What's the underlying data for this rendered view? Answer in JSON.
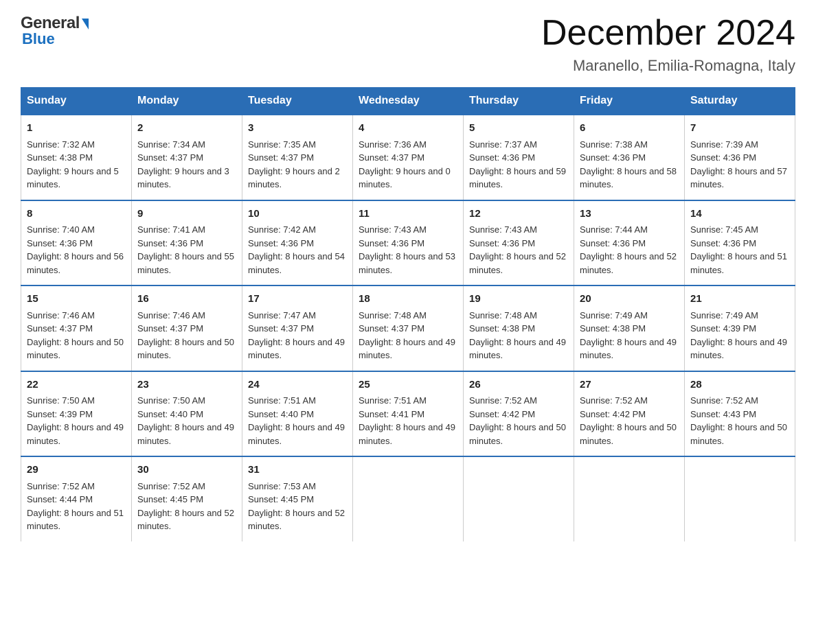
{
  "header": {
    "month_year": "December 2024",
    "location": "Maranello, Emilia-Romagna, Italy",
    "logo_general": "General",
    "logo_blue": "Blue"
  },
  "days_of_week": [
    "Sunday",
    "Monday",
    "Tuesday",
    "Wednesday",
    "Thursday",
    "Friday",
    "Saturday"
  ],
  "weeks": [
    [
      {
        "day": "1",
        "sunrise": "7:32 AM",
        "sunset": "4:38 PM",
        "daylight": "9 hours and 5 minutes."
      },
      {
        "day": "2",
        "sunrise": "7:34 AM",
        "sunset": "4:37 PM",
        "daylight": "9 hours and 3 minutes."
      },
      {
        "day": "3",
        "sunrise": "7:35 AM",
        "sunset": "4:37 PM",
        "daylight": "9 hours and 2 minutes."
      },
      {
        "day": "4",
        "sunrise": "7:36 AM",
        "sunset": "4:37 PM",
        "daylight": "9 hours and 0 minutes."
      },
      {
        "day": "5",
        "sunrise": "7:37 AM",
        "sunset": "4:36 PM",
        "daylight": "8 hours and 59 minutes."
      },
      {
        "day": "6",
        "sunrise": "7:38 AM",
        "sunset": "4:36 PM",
        "daylight": "8 hours and 58 minutes."
      },
      {
        "day": "7",
        "sunrise": "7:39 AM",
        "sunset": "4:36 PM",
        "daylight": "8 hours and 57 minutes."
      }
    ],
    [
      {
        "day": "8",
        "sunrise": "7:40 AM",
        "sunset": "4:36 PM",
        "daylight": "8 hours and 56 minutes."
      },
      {
        "day": "9",
        "sunrise": "7:41 AM",
        "sunset": "4:36 PM",
        "daylight": "8 hours and 55 minutes."
      },
      {
        "day": "10",
        "sunrise": "7:42 AM",
        "sunset": "4:36 PM",
        "daylight": "8 hours and 54 minutes."
      },
      {
        "day": "11",
        "sunrise": "7:43 AM",
        "sunset": "4:36 PM",
        "daylight": "8 hours and 53 minutes."
      },
      {
        "day": "12",
        "sunrise": "7:43 AM",
        "sunset": "4:36 PM",
        "daylight": "8 hours and 52 minutes."
      },
      {
        "day": "13",
        "sunrise": "7:44 AM",
        "sunset": "4:36 PM",
        "daylight": "8 hours and 52 minutes."
      },
      {
        "day": "14",
        "sunrise": "7:45 AM",
        "sunset": "4:36 PM",
        "daylight": "8 hours and 51 minutes."
      }
    ],
    [
      {
        "day": "15",
        "sunrise": "7:46 AM",
        "sunset": "4:37 PM",
        "daylight": "8 hours and 50 minutes."
      },
      {
        "day": "16",
        "sunrise": "7:46 AM",
        "sunset": "4:37 PM",
        "daylight": "8 hours and 50 minutes."
      },
      {
        "day": "17",
        "sunrise": "7:47 AM",
        "sunset": "4:37 PM",
        "daylight": "8 hours and 49 minutes."
      },
      {
        "day": "18",
        "sunrise": "7:48 AM",
        "sunset": "4:37 PM",
        "daylight": "8 hours and 49 minutes."
      },
      {
        "day": "19",
        "sunrise": "7:48 AM",
        "sunset": "4:38 PM",
        "daylight": "8 hours and 49 minutes."
      },
      {
        "day": "20",
        "sunrise": "7:49 AM",
        "sunset": "4:38 PM",
        "daylight": "8 hours and 49 minutes."
      },
      {
        "day": "21",
        "sunrise": "7:49 AM",
        "sunset": "4:39 PM",
        "daylight": "8 hours and 49 minutes."
      }
    ],
    [
      {
        "day": "22",
        "sunrise": "7:50 AM",
        "sunset": "4:39 PM",
        "daylight": "8 hours and 49 minutes."
      },
      {
        "day": "23",
        "sunrise": "7:50 AM",
        "sunset": "4:40 PM",
        "daylight": "8 hours and 49 minutes."
      },
      {
        "day": "24",
        "sunrise": "7:51 AM",
        "sunset": "4:40 PM",
        "daylight": "8 hours and 49 minutes."
      },
      {
        "day": "25",
        "sunrise": "7:51 AM",
        "sunset": "4:41 PM",
        "daylight": "8 hours and 49 minutes."
      },
      {
        "day": "26",
        "sunrise": "7:52 AM",
        "sunset": "4:42 PM",
        "daylight": "8 hours and 50 minutes."
      },
      {
        "day": "27",
        "sunrise": "7:52 AM",
        "sunset": "4:42 PM",
        "daylight": "8 hours and 50 minutes."
      },
      {
        "day": "28",
        "sunrise": "7:52 AM",
        "sunset": "4:43 PM",
        "daylight": "8 hours and 50 minutes."
      }
    ],
    [
      {
        "day": "29",
        "sunrise": "7:52 AM",
        "sunset": "4:44 PM",
        "daylight": "8 hours and 51 minutes."
      },
      {
        "day": "30",
        "sunrise": "7:52 AM",
        "sunset": "4:45 PM",
        "daylight": "8 hours and 52 minutes."
      },
      {
        "day": "31",
        "sunrise": "7:53 AM",
        "sunset": "4:45 PM",
        "daylight": "8 hours and 52 minutes."
      },
      null,
      null,
      null,
      null
    ]
  ]
}
